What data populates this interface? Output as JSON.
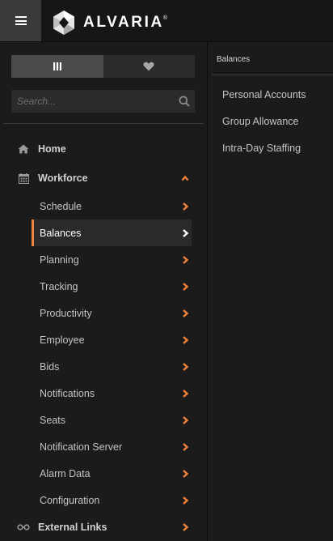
{
  "header": {
    "brand": "ALVARIA",
    "trademark": "®",
    "menu_icon": "hamburger-icon"
  },
  "sidebar": {
    "toggle": {
      "left_icon": "bars-icon",
      "right_icon": "heart-icon"
    },
    "search": {
      "placeholder": "Search...",
      "value": ""
    },
    "items": [
      {
        "label": "Home",
        "icon": "home-icon",
        "level": "top"
      },
      {
        "label": "Workforce",
        "icon": "calendar-icon",
        "level": "top",
        "expanded": true
      },
      {
        "label": "Schedule",
        "level": "sub"
      },
      {
        "label": "Balances",
        "level": "sub",
        "selected": true
      },
      {
        "label": "Planning",
        "level": "sub"
      },
      {
        "label": "Tracking",
        "level": "sub"
      },
      {
        "label": "Productivity",
        "level": "sub"
      },
      {
        "label": "Employee",
        "level": "sub"
      },
      {
        "label": "Bids",
        "level": "sub"
      },
      {
        "label": "Notifications",
        "level": "sub"
      },
      {
        "label": "Seats",
        "level": "sub"
      },
      {
        "label": "Notification Server",
        "level": "sub"
      },
      {
        "label": "Alarm Data",
        "level": "sub"
      },
      {
        "label": "Configuration",
        "level": "sub"
      },
      {
        "label": "External Links",
        "icon": "link-icon",
        "level": "top"
      }
    ]
  },
  "submenu": {
    "title": "Balances",
    "items": [
      "Personal Accounts",
      "Group Allowance",
      "Intra-Day Staffing"
    ]
  },
  "colors": {
    "accent": "#f0823a",
    "background": "#1b1b1b",
    "topbar": "#161616"
  }
}
